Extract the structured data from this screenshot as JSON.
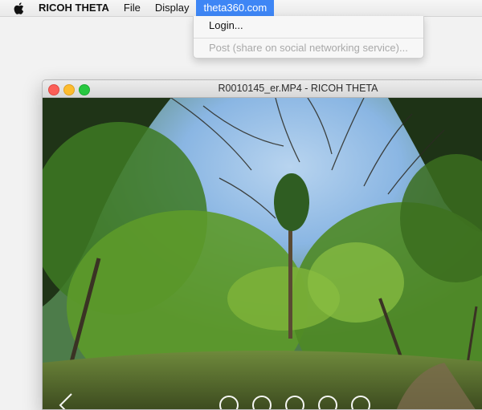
{
  "menubar": {
    "apple_icon": "apple-icon",
    "app_name": "RICOH THETA",
    "items": [
      "File",
      "Display",
      "theta360.com"
    ],
    "active_item": "theta360.com",
    "active_color": "#3e86f5"
  },
  "dropdown": {
    "items": [
      {
        "label": "Login...",
        "enabled": true
      },
      {
        "label": "Post (share on social networking service)...",
        "enabled": false
      }
    ]
  },
  "window": {
    "title": "R0010145_er.MP4 - RICOH THETA",
    "traffic_lights": [
      "close-icon",
      "minimize-icon",
      "zoom-icon"
    ],
    "viewer": {
      "content": "360-panorama-forest-image",
      "controls": [
        "back-arrow-icon",
        "zoom-in-icon",
        "zoom-out-icon",
        "view-mode-icon",
        "settings-icon",
        "info-icon"
      ]
    }
  }
}
